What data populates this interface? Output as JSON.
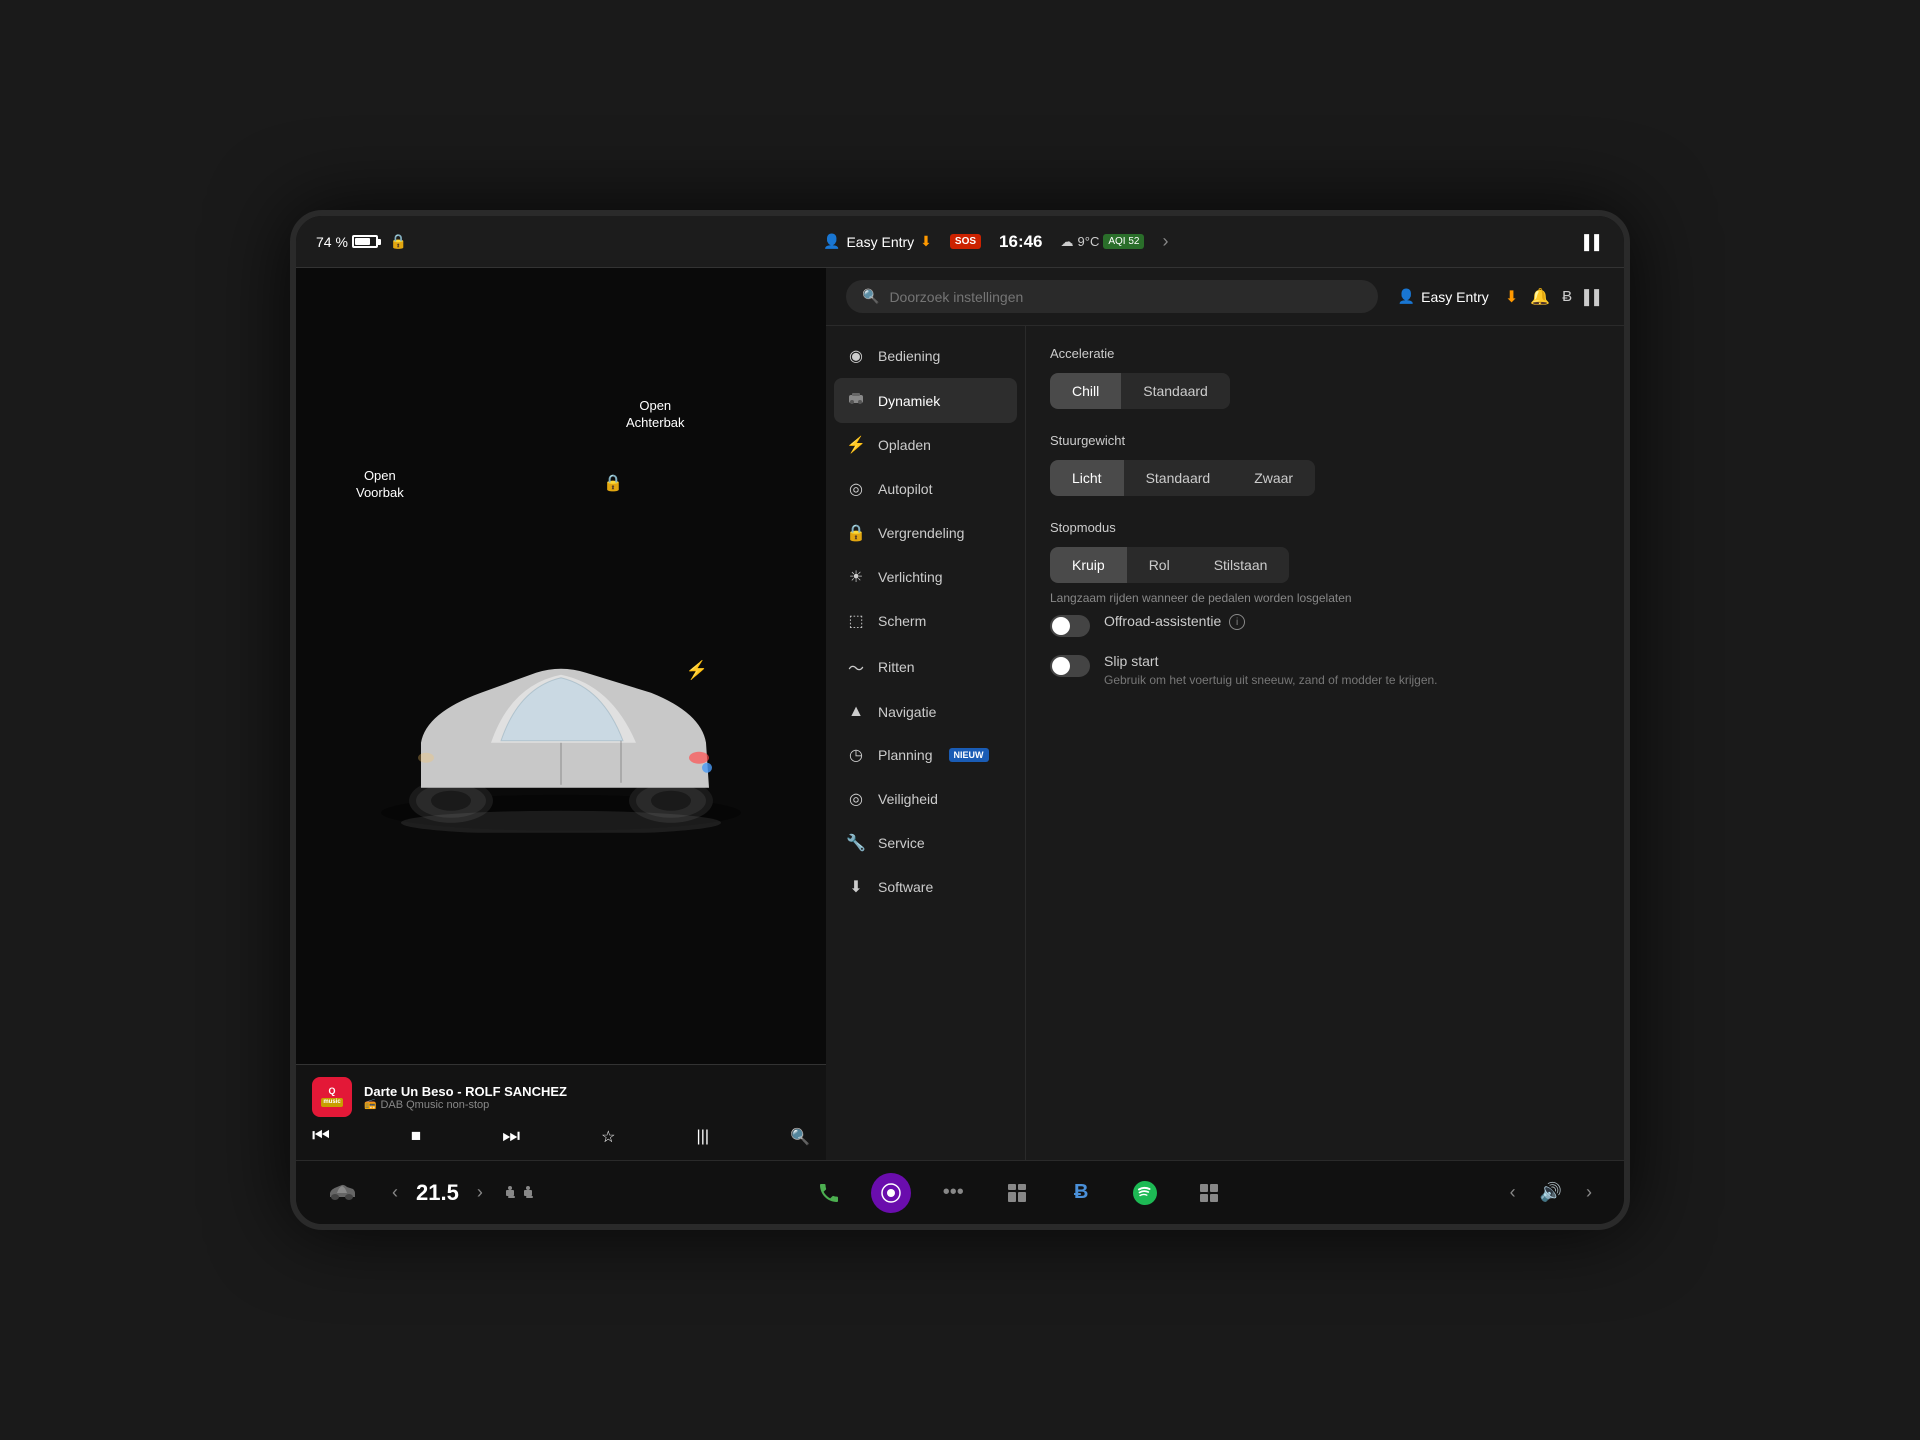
{
  "statusBar": {
    "battery": "74 %",
    "easyEntryTop": "Easy Entry",
    "sos": "SOS",
    "time": "16:46",
    "temp": "9°C",
    "aqi": "AQI 52",
    "chevronRight": "›"
  },
  "searchBar": {
    "placeholder": "Doorzoek instellingen",
    "profileLabel": "Easy Entry",
    "downloadIcon": "⬇",
    "bellIcon": "🔔",
    "bluetoothIcon": "Ƀ",
    "signalIcon": "▌▌"
  },
  "navItems": [
    {
      "id": "bediening",
      "icon": "◉",
      "label": "Bediening",
      "active": false,
      "badge": null
    },
    {
      "id": "dynamiek",
      "icon": "🚗",
      "label": "Dynamiek",
      "active": true,
      "badge": null
    },
    {
      "id": "opladen",
      "icon": "⚡",
      "label": "Opladen",
      "active": false,
      "badge": null
    },
    {
      "id": "autopilot",
      "icon": "◎",
      "label": "Autopilot",
      "active": false,
      "badge": null
    },
    {
      "id": "vergrendeling",
      "icon": "🔒",
      "label": "Vergrendeling",
      "active": false,
      "badge": null
    },
    {
      "id": "verlichting",
      "icon": "☀",
      "label": "Verlichting",
      "active": false,
      "badge": null
    },
    {
      "id": "scherm",
      "icon": "⬚",
      "label": "Scherm",
      "active": false,
      "badge": null
    },
    {
      "id": "ritten",
      "icon": "〜",
      "label": "Ritten",
      "active": false,
      "badge": null
    },
    {
      "id": "navigatie",
      "icon": "▲",
      "label": "Navigatie",
      "active": false,
      "badge": null
    },
    {
      "id": "planning",
      "icon": "◷",
      "label": "Planning",
      "active": false,
      "badge": "NIEUW"
    },
    {
      "id": "veiligheid",
      "icon": "◎",
      "label": "Veiligheid",
      "active": false,
      "badge": null
    },
    {
      "id": "service",
      "icon": "🔧",
      "label": "Service",
      "active": false,
      "badge": null
    },
    {
      "id": "software",
      "icon": "⬇",
      "label": "Software",
      "active": false,
      "badge": null
    }
  ],
  "dynamiek": {
    "acceleratie": {
      "title": "Acceleratie",
      "buttons": [
        {
          "id": "chill",
          "label": "Chill",
          "active": true
        },
        {
          "id": "standaard",
          "label": "Standaard",
          "active": false
        }
      ]
    },
    "stuurgewicht": {
      "title": "Stuurgewicht",
      "buttons": [
        {
          "id": "licht",
          "label": "Licht",
          "active": true
        },
        {
          "id": "standaard",
          "label": "Standaard",
          "active": false
        },
        {
          "id": "zwaar",
          "label": "Zwaar",
          "active": false
        }
      ]
    },
    "stopmodus": {
      "title": "Stopmodus",
      "buttons": [
        {
          "id": "kruip",
          "label": "Kruip",
          "active": true
        },
        {
          "id": "rol",
          "label": "Rol",
          "active": false
        },
        {
          "id": "stilstaan",
          "label": "Stilstaan",
          "active": false
        }
      ],
      "hint": "Langzaam rijden wanneer de pedalen worden losgelaten"
    },
    "offroadAssistentie": {
      "title": "Offroad-assistentie",
      "enabled": false,
      "hasInfo": true
    },
    "slipStart": {
      "title": "Slip start",
      "desc": "Gebruik om het voertuig uit sneeuw, zand of modder te krijgen.",
      "enabled": false
    }
  },
  "carLabels": {
    "openVoorbak": "Open\nVoorbak",
    "openAchterbak": "Open\nAchterbak"
  },
  "musicPlayer": {
    "logo": "Qmusic",
    "title": "Darte Un Beso - ROLF SANCHEZ",
    "station": "DAB Qmusic non-stop",
    "stationIcon": "📻"
  },
  "taskbar": {
    "carIcon": "🚗",
    "tempLeft": "‹",
    "temp": "21.5",
    "tempRight": "›",
    "phoneIcon": "📞",
    "circleIcon": "●",
    "dotsIcon": "●●●",
    "windowsIcon": "⊞",
    "bluetoothIcon": "Ƀ",
    "spotifyIcon": "♫",
    "gridIcon": "⊞",
    "chevLeft": "‹",
    "volIcon": "🔊",
    "chevRight": "›"
  }
}
